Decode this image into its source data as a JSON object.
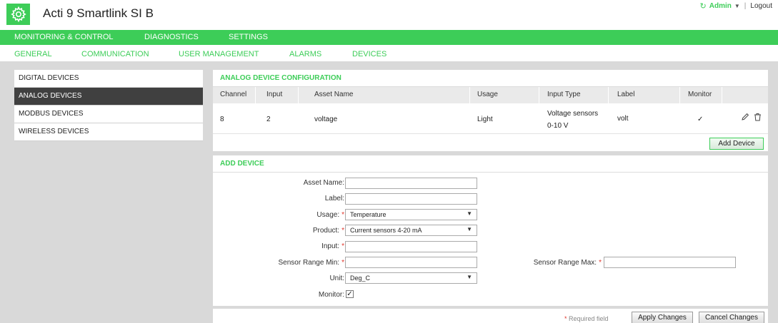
{
  "header": {
    "title": "Acti 9 Smartlink SI B",
    "user": "Admin",
    "logout": "Logout"
  },
  "mainnav": [
    "MONITORING & CONTROL",
    "DIAGNOSTICS",
    "SETTINGS"
  ],
  "subnav": [
    "GENERAL",
    "COMMUNICATION",
    "USER MANAGEMENT",
    "ALARMS",
    "DEVICES"
  ],
  "sidebar": [
    "DIGITAL DEVICES",
    "ANALOG DEVICES",
    "MODBUS DEVICES",
    "WIRELESS DEVICES"
  ],
  "config": {
    "title": "ANALOG DEVICE CONFIGURATION",
    "columns": [
      "Channel",
      "Input",
      "Asset Name",
      "Usage",
      "Input Type",
      "Label",
      "Monitor"
    ],
    "row": {
      "channel": "8",
      "input": "2",
      "asset": "voltage",
      "usage": "Light",
      "type_line1": "Voltage sensors",
      "type_line2": "0-10 V",
      "label": "volt",
      "monitor": "✓"
    },
    "add_button": "Add Device"
  },
  "form": {
    "title": "ADD DEVICE",
    "asset_label": "Asset Name:",
    "label_label": "Label:",
    "usage_label": "Usage:",
    "usage_value": "Temperature",
    "product_label": "Product:",
    "product_value": "Current sensors 4-20 mA",
    "input_label": "Input:",
    "min_label": "Sensor Range Min:",
    "max_label": "Sensor Range Max:",
    "unit_label": "Unit:",
    "unit_value": "Deg_C",
    "monitor_label": "Monitor:",
    "monitor_checked": "✓",
    "required_mark": "*"
  },
  "footer": {
    "required_note": "Required field",
    "apply": "Apply Changes",
    "cancel": "Cancel Changes"
  },
  "colors": {
    "brand": "#3dcd58",
    "active": "#404040",
    "required": "#e0352b"
  }
}
